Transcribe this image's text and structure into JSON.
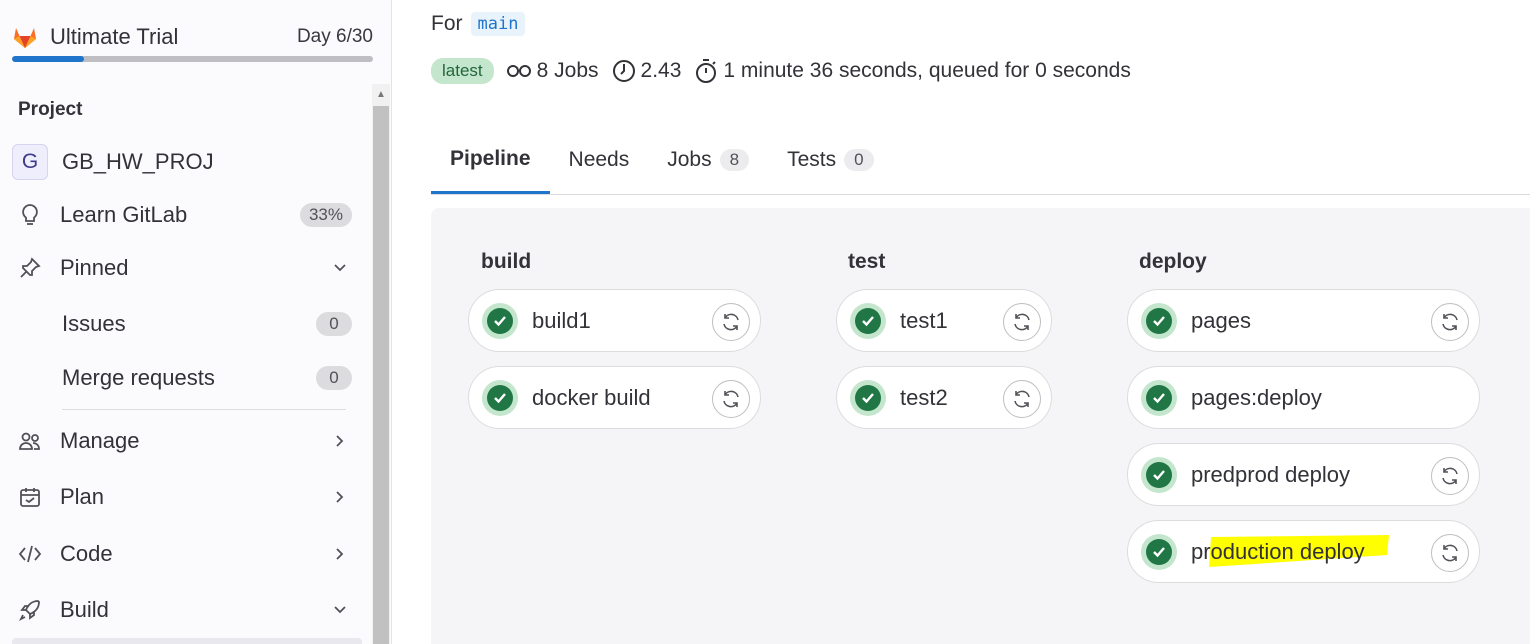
{
  "sidebar": {
    "trial": {
      "title": "Ultimate Trial",
      "day": "Day 6/30",
      "progress": 0.2
    },
    "section_label": "Project",
    "project": {
      "avatar_letter": "G",
      "name": "GB_HW_PROJ"
    },
    "items": [
      {
        "label": "Learn GitLab",
        "badge": "33%",
        "icon": "bulb-icon"
      },
      {
        "label": "Pinned",
        "icon": "pin-icon",
        "expanded": true
      },
      {
        "label": "Issues",
        "badge": "0"
      },
      {
        "label": "Merge requests",
        "badge": "0"
      },
      {
        "label": "Manage",
        "icon": "users-icon"
      },
      {
        "label": "Plan",
        "icon": "calendar-icon"
      },
      {
        "label": "Code",
        "icon": "code-icon"
      },
      {
        "label": "Build",
        "icon": "rocket-icon",
        "expanded": true
      }
    ]
  },
  "header": {
    "for_label": "For",
    "branch": "main",
    "latest_badge": "latest",
    "jobs_count": "8 Jobs",
    "compute": "2.43",
    "duration": "1 minute 36 seconds, queued for 0 seconds"
  },
  "tabs": [
    {
      "label": "Pipeline",
      "active": true
    },
    {
      "label": "Needs"
    },
    {
      "label": "Jobs",
      "count": "8"
    },
    {
      "label": "Tests",
      "count": "0"
    }
  ],
  "stages": [
    {
      "name": "build",
      "jobs": [
        "build1",
        "docker build"
      ]
    },
    {
      "name": "test",
      "jobs": [
        "test1",
        "test2"
      ]
    },
    {
      "name": "deploy",
      "jobs": [
        "pages",
        "pages:deploy",
        "predprod deploy",
        "production deploy"
      ]
    }
  ],
  "colors": {
    "accent": "#1f75cb",
    "success": "#217645",
    "highlight": "#ffff00"
  }
}
